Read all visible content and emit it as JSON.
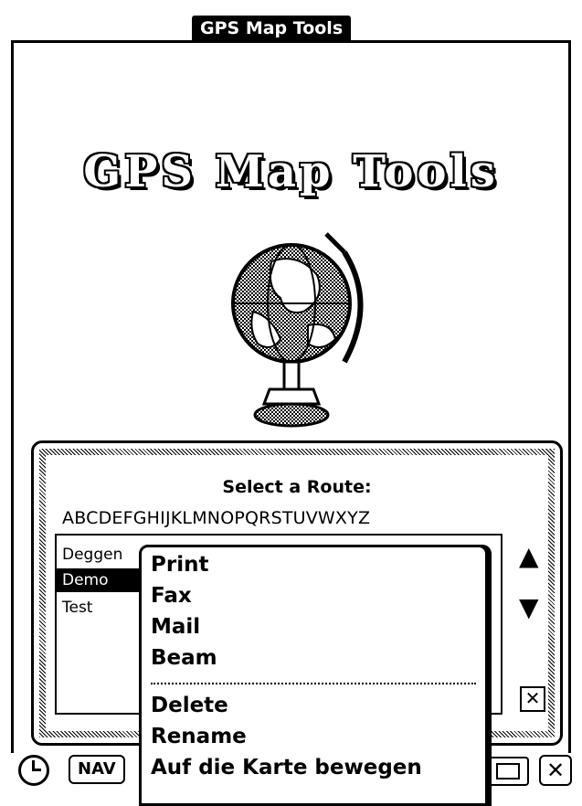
{
  "titlebar": {
    "title": "GPS Map Tools"
  },
  "logo": {
    "text": "GPS Map Tools"
  },
  "dialog": {
    "title": "Select a Route:",
    "alphabet": "ABCDEFGHIJKLMNOPQRSTUVWXYZ",
    "routes": [
      "Deggen",
      "Demo",
      "Test"
    ],
    "selected_route": "Demo"
  },
  "menu": {
    "items_top": [
      "Print",
      "Fax",
      "Mail",
      "Beam"
    ],
    "items_bottom": [
      "Delete",
      "Rename",
      "Auf die Karte bewegen"
    ]
  },
  "bottombar": {
    "nav_label": "NAV"
  }
}
